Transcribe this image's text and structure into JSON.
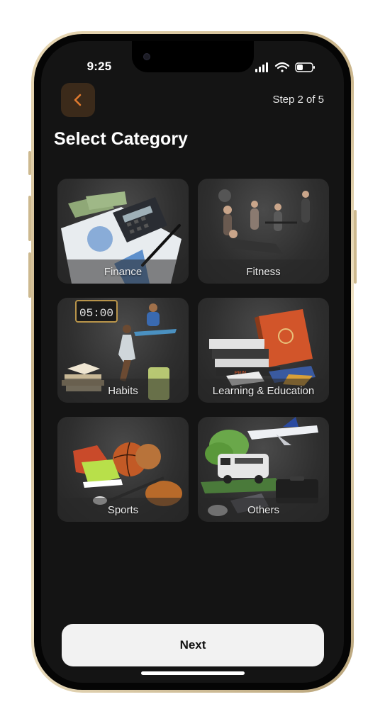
{
  "status_bar": {
    "time": "9:25"
  },
  "header": {
    "back_icon": "chevron-left-icon",
    "step_text": "Step 2 of 5"
  },
  "page": {
    "title": "Select Category"
  },
  "categories": [
    {
      "label": "Finance"
    },
    {
      "label": "Fitness"
    },
    {
      "label": "Habits"
    },
    {
      "label": "Learning & Education"
    },
    {
      "label": "Sports"
    },
    {
      "label": "Others"
    }
  ],
  "footer": {
    "next_label": "Next"
  },
  "colors": {
    "accent": "#e07a2e",
    "back_bg": "#3b2a1a",
    "screen_bg": "#141414",
    "button_bg": "#f2f2f2"
  }
}
